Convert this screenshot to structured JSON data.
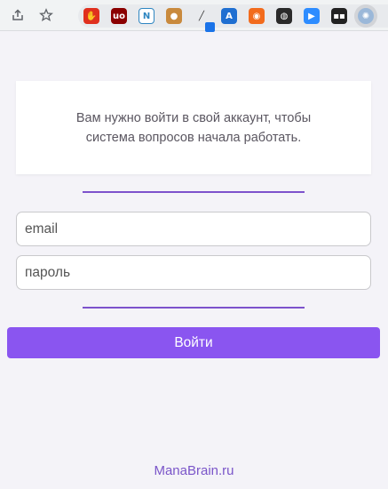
{
  "browser": {
    "share_icon": "share-icon",
    "bookmark_icon": "star-icon",
    "extensions": [
      {
        "name": "adblock-extension-icon",
        "glyph": "✋",
        "bg": "#e0301e"
      },
      {
        "name": "ublock-extension-icon",
        "glyph": "uo",
        "bg": "#8b0000"
      },
      {
        "name": "notion-extension-icon",
        "glyph": "N",
        "bg": "#2e86c1"
      },
      {
        "name": "cookie-extension-icon",
        "glyph": "●",
        "bg": "#c98a3d"
      },
      {
        "name": "eyedropper-extension-icon",
        "glyph": "╱",
        "bg": "#333333"
      },
      {
        "name": "acrobat-extension-icon",
        "glyph": "A",
        "bg": "#1f6fd1"
      },
      {
        "name": "orange-extension-icon",
        "glyph": "◉",
        "bg": "#f26b1d"
      },
      {
        "name": "color-wheel-extension-icon",
        "glyph": "◍",
        "bg": "#2a2a2a"
      },
      {
        "name": "zoom-extension-icon",
        "glyph": "▶",
        "bg": "#2d8cff"
      },
      {
        "name": "dark-extension-icon",
        "glyph": "▪▪",
        "bg": "#222222"
      },
      {
        "name": "brain-extension-icon",
        "glyph": "✺",
        "bg": "#9bb8d9"
      }
    ]
  },
  "message": {
    "text": "Вам нужно войти в свой аккаунт, чтобы система вопросов начала работать."
  },
  "form": {
    "email_placeholder": "email",
    "password_placeholder": "пароль",
    "login_label": "Войти"
  },
  "footer": {
    "link_text": "ManaBrain.ru"
  },
  "colors": {
    "accent": "#8a55f0",
    "divider": "#7d52cc",
    "footer_link": "#7a55c9",
    "background": "#f4f3f8"
  }
}
